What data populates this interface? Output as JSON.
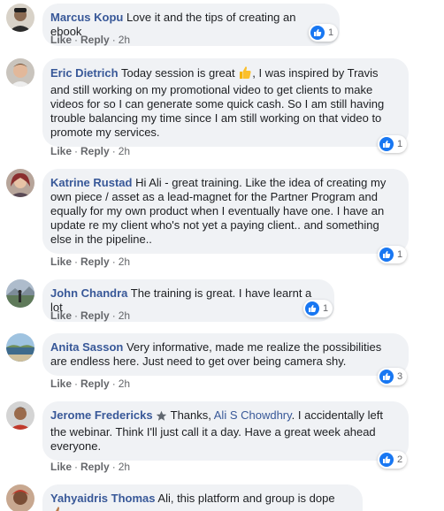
{
  "comments": [
    {
      "author": "Marcus Kopu",
      "text": " Love it and the tips of creating an ebook",
      "like_label": "Like",
      "reply_label": "Reply",
      "time": "2h",
      "reaction_count": "1"
    },
    {
      "author": "Eric Dietrich",
      "text_a": " Today session is great ",
      "text_b": ", I was inspired by Travis and still working on my promotional video to get clients to make videos for so I can generate some quick cash. So I am still having trouble balancing my time since I am still working on that video to promote my services.",
      "emoji": "thumbs-up-emoji",
      "like_label": "Like",
      "reply_label": "Reply",
      "time": "2h",
      "reaction_count": "1"
    },
    {
      "author": "Katrine Rustad",
      "text": " Hi Ali - great training. Like the idea of creating my own piece / asset as a lead-magnet for the Partner Program and equally for my own product when I eventually have one. I have an update re my client who's not yet a paying client.. and something else in the pipeline..",
      "like_label": "Like",
      "reply_label": "Reply",
      "time": "2h",
      "reaction_count": "1"
    },
    {
      "author": "John Chandra",
      "text": " The training is great. I have learnt a lot",
      "like_label": "Like",
      "reply_label": "Reply",
      "time": "2h",
      "reaction_count": "1"
    },
    {
      "author": "Anita Sasson",
      "text": " Very informative, made me realize the possibilities are endless here. Just need to get over being camera shy.",
      "like_label": "Like",
      "reply_label": "Reply",
      "time": "2h",
      "reaction_count": "3"
    },
    {
      "author": "Jerome Fredericks",
      "badge": "star-badge-icon",
      "text_a": " Thanks, ",
      "mention": "Ali S Chowdhry",
      "text_b": ". I accidentally left the webinar. Think I'll just call it a day. Have a great week ahead everyone.",
      "like_label": "Like",
      "reply_label": "Reply",
      "time": "2h",
      "reaction_count": "2"
    },
    {
      "author": "Yahyaidris Thomas",
      "text": " Ali, this platform and group is dope ",
      "emoji": "thumbs-up-emoji"
    }
  ],
  "colors": {
    "link": "#385898",
    "bubble": "#f0f2f5",
    "like": "#1877f2",
    "meta": "#65676b"
  }
}
